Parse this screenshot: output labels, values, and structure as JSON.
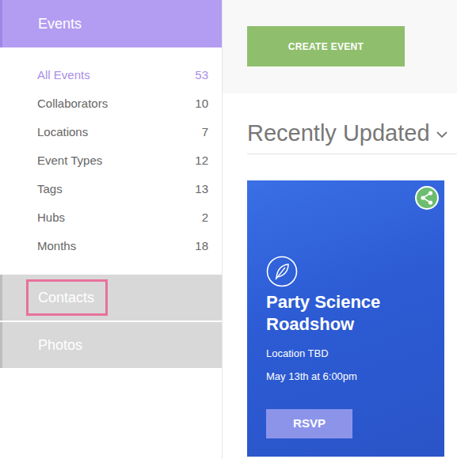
{
  "sidebar": {
    "sections": [
      {
        "label": "Events",
        "selected": true,
        "highlighted": false,
        "items": [
          {
            "label": "All Events",
            "count": "53",
            "selected": true
          },
          {
            "label": "Collaborators",
            "count": "10",
            "selected": false
          },
          {
            "label": "Locations",
            "count": "7",
            "selected": false
          },
          {
            "label": "Event Types",
            "count": "12",
            "selected": false
          },
          {
            "label": "Tags",
            "count": "13",
            "selected": false
          },
          {
            "label": "Hubs",
            "count": "2",
            "selected": false
          },
          {
            "label": "Months",
            "count": "18",
            "selected": false
          }
        ]
      },
      {
        "label": "Contacts",
        "selected": false,
        "highlighted": true,
        "items": []
      },
      {
        "label": "Photos",
        "selected": false,
        "highlighted": false,
        "items": []
      }
    ]
  },
  "toolbar": {
    "create_button": "CREATE EVENT"
  },
  "section_title": "Recently Updated",
  "events": [
    {
      "title": "Party Science Roadshow",
      "location": "Location TBD",
      "date": "May 13th at 6:00pm",
      "rsvp": "RSVP"
    }
  ]
}
